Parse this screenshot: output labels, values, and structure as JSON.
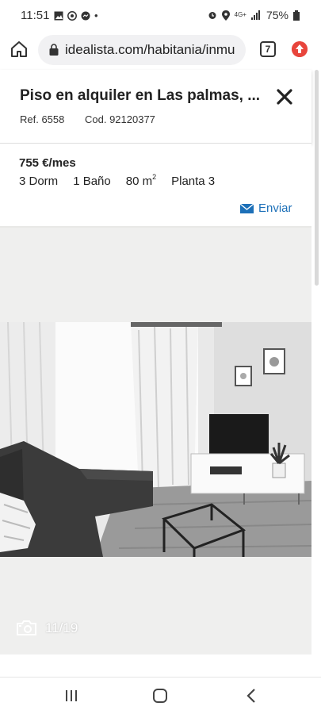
{
  "status_bar": {
    "time": "11:51",
    "dot": "•",
    "network": "4G+",
    "battery": "75%"
  },
  "browser": {
    "url": "idealista.com/habitania/inmu",
    "tab_count": "7"
  },
  "listing": {
    "title": "Piso en alquiler en Las palmas, ...",
    "ref": "Ref. 6558",
    "cod": "Cod. 92120377",
    "price": "755 €/mes",
    "features": {
      "bedrooms": "3 Dorm",
      "bathrooms": "1 Baño",
      "area": "80 m",
      "area_unit_sup": "2",
      "floor": "Planta 3"
    },
    "send_label": "Enviar"
  },
  "gallery": {
    "counter": "11/19"
  },
  "colors": {
    "link": "#1d70b8",
    "browser_update": "#e8453c",
    "gallery_bg": "#efefee"
  },
  "icons": [
    "home-icon",
    "lock-icon",
    "tabs-icon",
    "update-icon",
    "close-icon",
    "mail-icon",
    "camera-icon",
    "recent-apps-icon",
    "home-nav-icon",
    "back-icon"
  ]
}
